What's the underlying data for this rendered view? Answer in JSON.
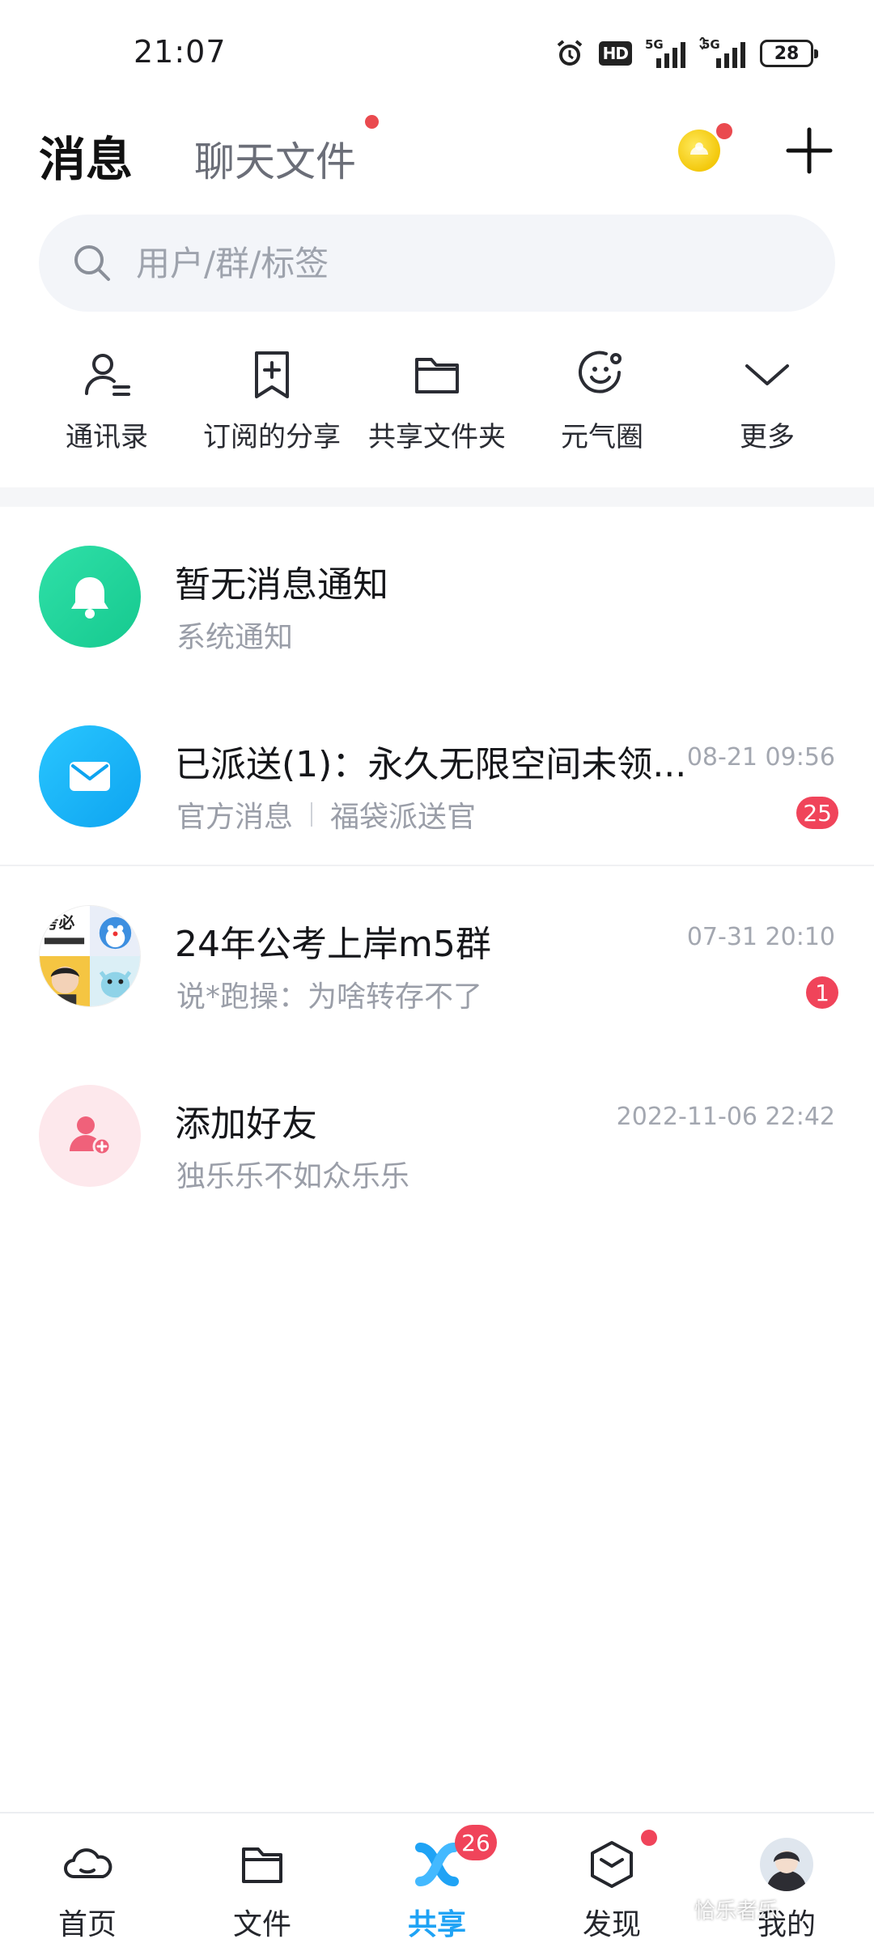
{
  "status_bar": {
    "time": "21:07",
    "hd_label": "HD",
    "net1": "5G",
    "net2": "5G",
    "battery": "28"
  },
  "header": {
    "tab_messages": "消息",
    "tab_files": "聊天文件"
  },
  "search": {
    "placeholder": "用户/群/标签"
  },
  "shortcuts": [
    {
      "label": "通讯录",
      "icon": "contacts-icon"
    },
    {
      "label": "订阅的分享",
      "icon": "subscribe-icon"
    },
    {
      "label": "共享文件夹",
      "icon": "folder-icon"
    },
    {
      "label": "元气圈",
      "icon": "smile-circle-icon"
    },
    {
      "label": "更多",
      "icon": "chevron-down-icon"
    }
  ],
  "messages": [
    {
      "title": "暂无消息通知",
      "subtitle": "系统通知",
      "avatar": "bell-icon"
    },
    {
      "title": "已派送(1)：永久无限空间未领...",
      "subtitle_a": "官方消息",
      "subtitle_b": "福袋派送官",
      "time": "08-21 09:56",
      "badge": "25",
      "avatar": "mail-icon"
    },
    {
      "title": "24年公考上岸m5群",
      "subtitle": "说*跑操：为啥转存不了",
      "time": "07-31 20:10",
      "badge": "1",
      "avatar": "group-avatar",
      "avatar_text": "考必"
    },
    {
      "title": "添加好友",
      "subtitle": "独乐乐不如众乐乐",
      "time": "2022-11-06 22:42",
      "avatar": "add-user-icon"
    }
  ],
  "bottom_nav": [
    {
      "label": "首页",
      "icon": "cloud-icon"
    },
    {
      "label": "文件",
      "icon": "folder-icon"
    },
    {
      "label": "共享",
      "icon": "share-icon",
      "badge": "26"
    },
    {
      "label": "发现",
      "icon": "cube-icon"
    },
    {
      "label": "我的",
      "icon": "avatar"
    }
  ],
  "watermark": "恰乐者乐",
  "colors": {
    "accent": "#1fa3f5",
    "badge": "#f0445a",
    "bell": "#16c98f",
    "mail": "#0ea4f0"
  }
}
